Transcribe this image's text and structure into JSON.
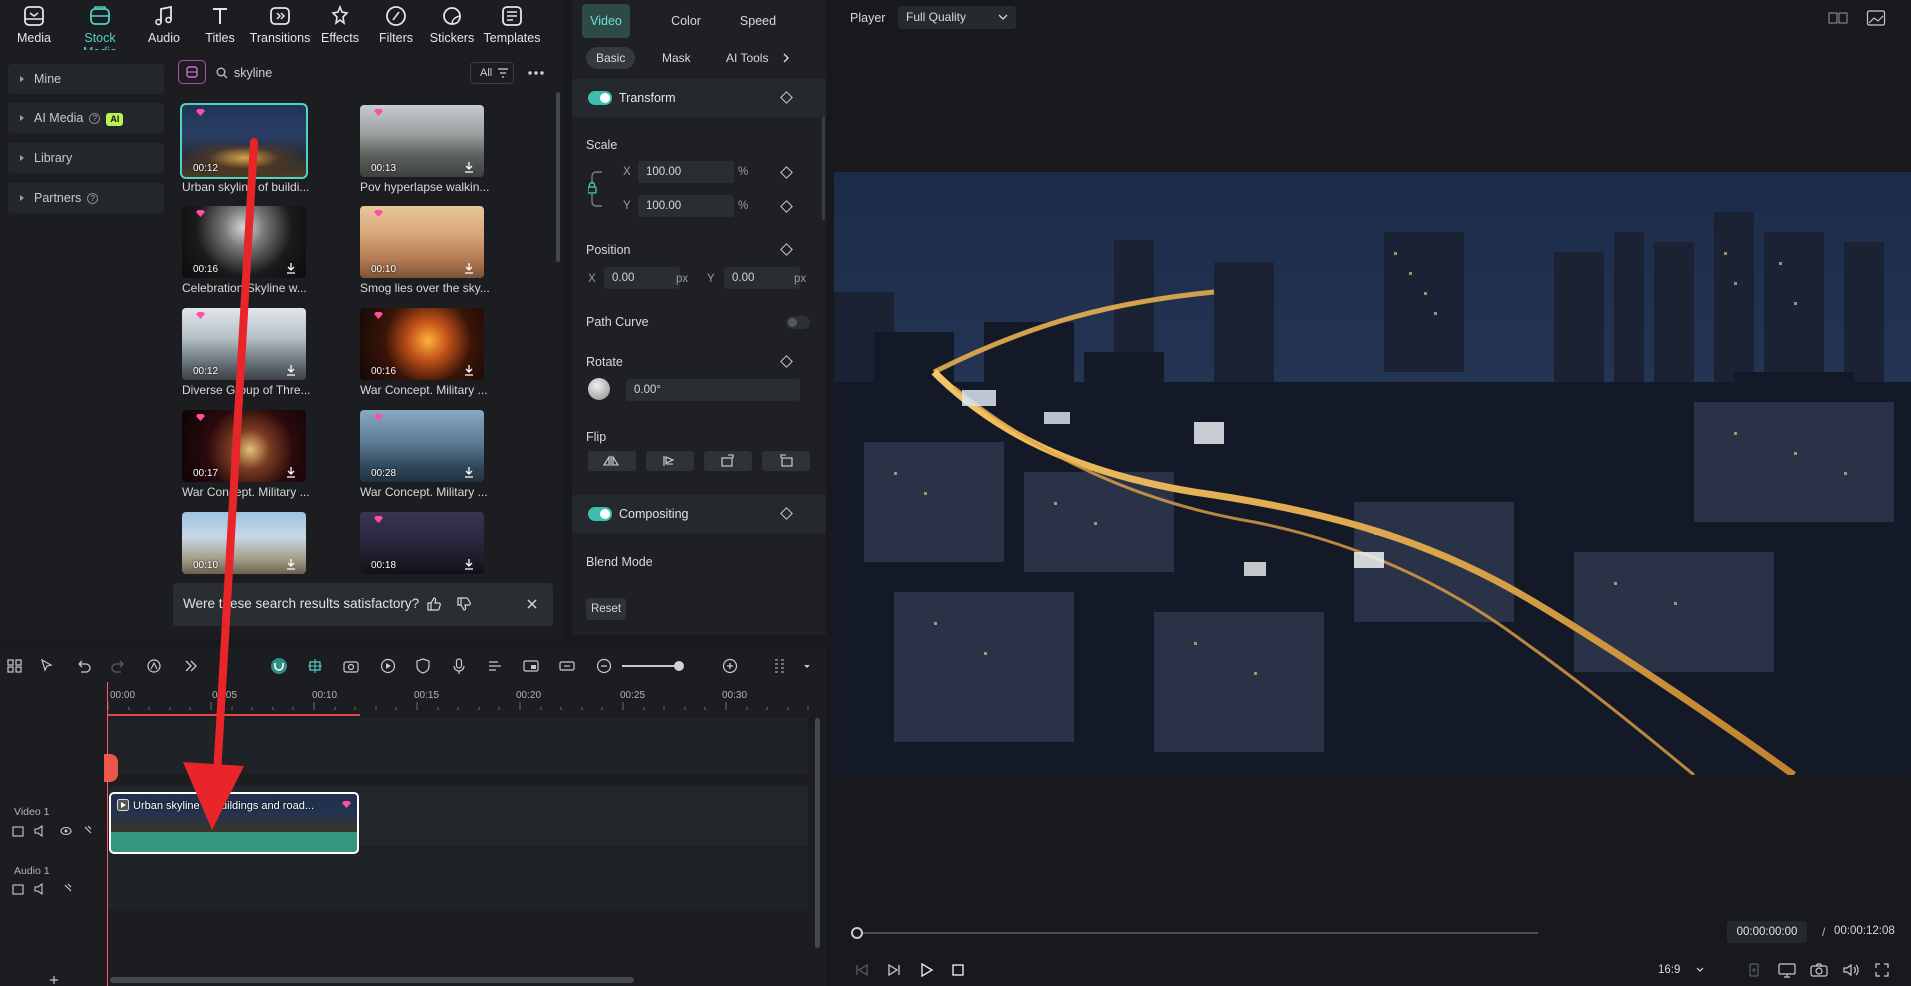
{
  "toolbar": {
    "items": [
      {
        "label": "Media",
        "icon": "media-icon"
      },
      {
        "label": "Stock Media",
        "icon": "stock-media-icon",
        "active": true
      },
      {
        "label": "Audio",
        "icon": "audio-icon"
      },
      {
        "label": "Titles",
        "icon": "titles-icon"
      },
      {
        "label": "Transitions",
        "icon": "transitions-icon"
      },
      {
        "label": "Effects",
        "icon": "effects-icon"
      },
      {
        "label": "Filters",
        "icon": "filters-icon"
      },
      {
        "label": "Stickers",
        "icon": "stickers-icon"
      },
      {
        "label": "Templates",
        "icon": "templates-icon"
      }
    ]
  },
  "leftnav": {
    "items": [
      {
        "label": "Mine"
      },
      {
        "label": "AI Media",
        "badge": "AI"
      },
      {
        "label": "Library"
      },
      {
        "label": "Partners"
      }
    ]
  },
  "search": {
    "value": "skyline",
    "filter_label": "All"
  },
  "results": [
    {
      "title": "Urban skyline of buildi...",
      "duration": "00:12",
      "selected": true
    },
    {
      "title": "Pov hyperlapse walkin...",
      "duration": "00:13"
    },
    {
      "title": "Celebration Skyline w...",
      "duration": "00:16"
    },
    {
      "title": "Smog lies over the sky...",
      "duration": "00:10"
    },
    {
      "title": "Diverse Group of Thre...",
      "duration": "00:12"
    },
    {
      "title": "War Concept. Military ...",
      "duration": "00:16"
    },
    {
      "title": "War Concept. Military ...",
      "duration": "00:17"
    },
    {
      "title": "War Concept. Military ...",
      "duration": "00:28"
    },
    {
      "title": "",
      "duration": "00:10"
    },
    {
      "title": "",
      "duration": "00:18"
    }
  ],
  "feedback": {
    "question": "Were these search results satisfactory?"
  },
  "properties": {
    "tabs": [
      "Video",
      "Color",
      "Speed"
    ],
    "subtabs": [
      "Basic",
      "Mask",
      "AI Tools"
    ],
    "transform_label": "Transform",
    "scale_label": "Scale",
    "scale_x": "100.00",
    "scale_y": "100.00",
    "percent": "%",
    "x_label": "X",
    "y_label": "Y",
    "position_label": "Position",
    "pos_x": "0.00",
    "pos_y": "0.00",
    "px": "px",
    "path_curve_label": "Path Curve",
    "rotate_label": "Rotate",
    "rotate_value": "0.00°",
    "flip_label": "Flip",
    "compositing_label": "Compositing",
    "blend_mode_label": "Blend Mode",
    "reset_label": "Reset"
  },
  "timeline": {
    "ruler": [
      "00:00",
      "00:05",
      "00:10",
      "00:15",
      "00:20",
      "00:25",
      "00:30"
    ],
    "tracks": [
      {
        "name": "Video 1"
      },
      {
        "name": "Audio 1"
      }
    ],
    "clip_title": "Urban skyline of buildings and road..."
  },
  "player": {
    "label": "Player",
    "quality": "Full Quality",
    "current_time": "00:00:00:00",
    "separator": "/",
    "total_time": "00:00:12:08",
    "aspect": "16:9"
  },
  "colors": {
    "accent": "#4fd1c5",
    "annotation_arrow": "#e8262a",
    "playhead": "#ff5a5f"
  }
}
